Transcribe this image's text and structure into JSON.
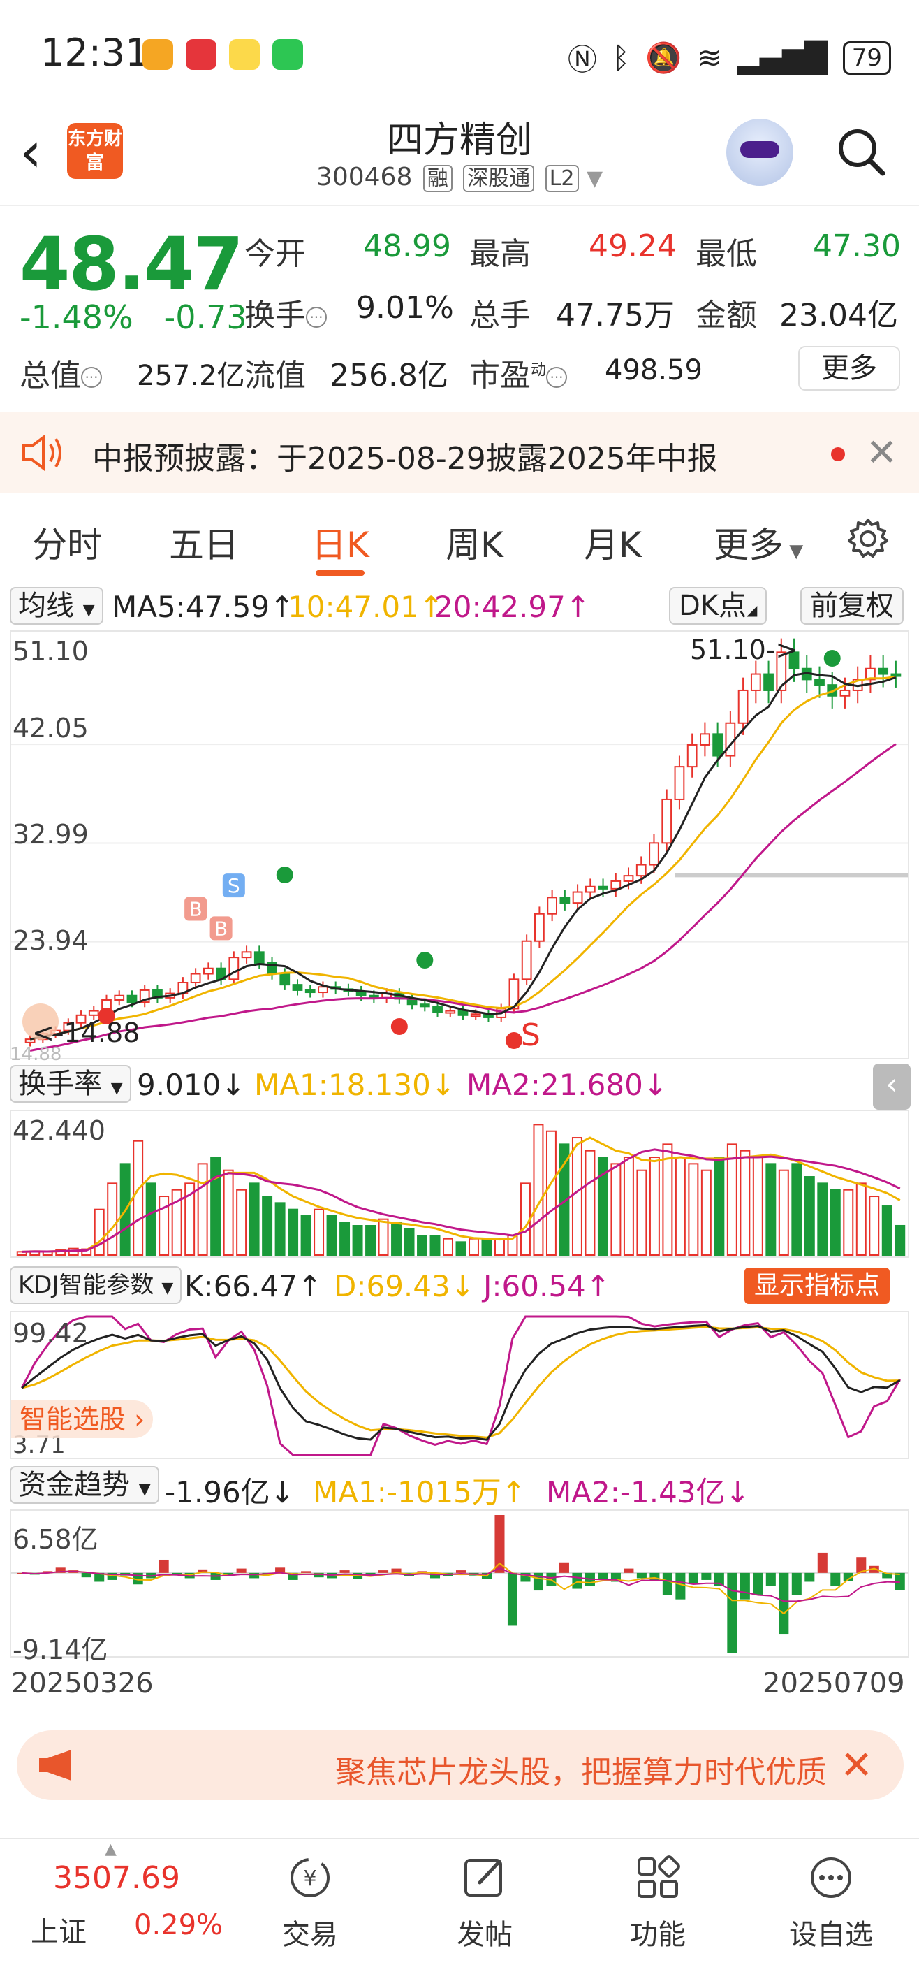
{
  "status_bar": {
    "time": "12:31",
    "battery": "79"
  },
  "header": {
    "logo_text": "东方财富",
    "title": "四方精创",
    "code": "300468",
    "tags": [
      "融",
      "深股通",
      "L2"
    ]
  },
  "quote": {
    "price": "48.47",
    "change_pct": "-1.48%",
    "change_abs": "-0.73",
    "open_label": "今开",
    "open": "48.99",
    "high_label": "最高",
    "high": "49.24",
    "low_label": "最低",
    "low": "47.30",
    "turnover_label": "换手",
    "turnover": "9.01%",
    "volume_label": "总手",
    "volume": "47.75万",
    "amount_label": "金额",
    "amount": "23.04亿",
    "mktcap_label": "总值",
    "mktcap": "257.2亿",
    "float_label": "流值",
    "float": "256.8亿",
    "pe_label": "市盈",
    "pe_sup": "动",
    "pe": "498.59",
    "more": "更多"
  },
  "notice": {
    "text": "中报预披露：于2025-08-29披露2025年中报"
  },
  "tabs": [
    "分时",
    "五日",
    "日K",
    "周K",
    "月K",
    "更多"
  ],
  "kline": {
    "selector": "均线",
    "ma5": "MA5:47.59",
    "ma10": "10:47.01",
    "ma20": "20:42.97",
    "dk_button": "DK点",
    "adjust_button": "前复权",
    "y_ticks": [
      "51.10",
      "42.05",
      "32.99",
      "23.94",
      "14.88"
    ],
    "high_marker": "51.10->",
    "low_marker": "<-14.88",
    "signal_b": "B",
    "signal_s": "S"
  },
  "turnover_panel": {
    "selector": "换手率",
    "value": "9.010",
    "ma1": "MA1:18.130",
    "ma2": "MA2:21.680",
    "y_top": "42.440"
  },
  "kdj_panel": {
    "selector": "KDJ智能参数",
    "k": "K:66.47",
    "d": "D:69.43",
    "j": "J:60.54",
    "show_button": "显示指标点",
    "y_top": "99.42",
    "y_bottom": "3.71",
    "smart_pick": "智能选股"
  },
  "fund_panel": {
    "selector": "资金趋势",
    "value": "-1.96亿",
    "ma1": "MA1:-1015万",
    "ma2": "MA2:-1.43亿",
    "y_top": "6.58亿",
    "y_bottom": "-9.14亿"
  },
  "dates": {
    "start": "20250326",
    "end": "20250709"
  },
  "ad": {
    "text": "聚焦芯片龙头股，把握算力时代优质"
  },
  "bottom_nav": {
    "index_value": "3507.69",
    "index_name": "上证",
    "index_change": "0.29%",
    "items": [
      "交易",
      "发帖",
      "功能",
      "设自选"
    ]
  },
  "chart_data": [
    {
      "type": "candlestick",
      "title": "日K",
      "x_range": [
        "20250326",
        "20250709"
      ],
      "ylim": [
        14.88,
        51.1
      ],
      "y_ticks": [
        51.1,
        42.05,
        32.99,
        23.94,
        14.88
      ],
      "series": [
        {
          "name": "MA5",
          "last": 47.59
        },
        {
          "name": "MA10",
          "last": 47.01
        },
        {
          "name": "MA20",
          "last": 42.97
        }
      ],
      "approx_close": [
        15.0,
        15.5,
        15.8,
        16.5,
        17.2,
        17.6,
        18.6,
        19.0,
        18.4,
        19.5,
        18.8,
        19.2,
        20.2,
        21.0,
        21.5,
        20.5,
        22.5,
        23.0,
        22.0,
        21.0,
        20.0,
        19.5,
        19.3,
        19.8,
        19.6,
        19.4,
        19.0,
        18.8,
        19.2,
        18.7,
        18.2,
        18.0,
        17.5,
        17.6,
        17.2,
        17.3,
        17.0,
        17.8,
        20.5,
        24.0,
        26.5,
        28.0,
        27.5,
        28.5,
        29.0,
        28.8,
        29.5,
        30.0,
        31.0,
        33.0,
        37.0,
        40.0,
        42.0,
        43.0,
        41.0,
        44.0,
        47.0,
        48.5,
        47.0,
        50.5,
        49.0,
        48.0,
        47.5,
        46.5,
        47.0,
        48.0,
        49.0,
        48.5,
        48.47
      ]
    },
    {
      "type": "bar",
      "title": "换手率",
      "ylim": [
        0,
        42.44
      ],
      "values": [
        1.0,
        1.2,
        1.0,
        1.5,
        2.0,
        1.8,
        14.0,
        22.0,
        28.0,
        35.0,
        22.0,
        18.0,
        20.0,
        22.0,
        28.0,
        30.0,
        26.0,
        20.0,
        22.0,
        18.0,
        16.0,
        14.0,
        12.0,
        14.0,
        12.0,
        10.0,
        9.0,
        9.0,
        11.0,
        10.0,
        8.0,
        6.0,
        6.0,
        5.0,
        4.0,
        5.0,
        5.0,
        5.0,
        6.0,
        22.0,
        40.0,
        38.0,
        34.0,
        36.0,
        32.0,
        30.0,
        28.0,
        30.0,
        26.0,
        30.0,
        34.0,
        30.0,
        28.0,
        26.0,
        30.0,
        34.0,
        32.0,
        30.0,
        28.0,
        26.0,
        28.0,
        24.0,
        22.0,
        20.0,
        20.0,
        22.0,
        18.0,
        15.0,
        9.01
      ],
      "series": [
        {
          "name": "MA1",
          "last": 18.13
        },
        {
          "name": "MA2",
          "last": 21.68
        }
      ]
    },
    {
      "type": "line",
      "title": "KDJ",
      "ylim": [
        3.71,
        99.42
      ],
      "series": [
        {
          "name": "K",
          "last": 66.47
        },
        {
          "name": "D",
          "last": 69.43
        },
        {
          "name": "J",
          "last": 60.54
        }
      ]
    },
    {
      "type": "bar",
      "title": "资金趋势",
      "ylim": [
        -9.14,
        6.58
      ],
      "values": [
        0.0,
        -0.2,
        0.2,
        0.6,
        0.3,
        -0.5,
        -1.0,
        -0.8,
        -0.3,
        -1.3,
        -0.6,
        1.5,
        -0.2,
        -0.6,
        0.4,
        -0.8,
        -0.3,
        0.5,
        -0.6,
        -0.2,
        0.6,
        -0.8,
        0.2,
        -0.5,
        -0.6,
        0.3,
        -0.7,
        -0.4,
        0.3,
        0.5,
        -0.4,
        0.2,
        -0.6,
        -0.4,
        0.3,
        -0.3,
        -0.7,
        6.58,
        -6.0,
        -1.0,
        -2.0,
        -1.5,
        1.2,
        -1.8,
        -1.5,
        -0.8,
        -1.0,
        0.5,
        -0.6,
        -0.9,
        -2.5,
        -3.0,
        -1.2,
        -0.8,
        -1.5,
        -9.14,
        -3.0,
        -2.5,
        -1.5,
        -7.0,
        -2.5,
        -1.0,
        2.3,
        -1.5,
        -0.9,
        1.8,
        0.8,
        -0.6,
        -1.96
      ],
      "series": [
        {
          "name": "MA1",
          "last": -0.1015
        },
        {
          "name": "MA2",
          "last": -1.43
        }
      ]
    }
  ]
}
